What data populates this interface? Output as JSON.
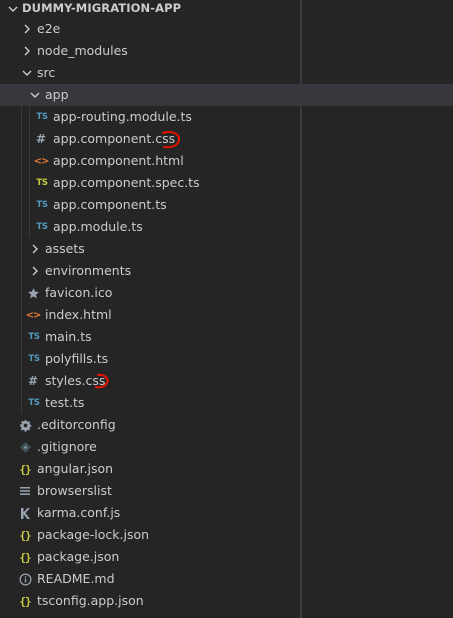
{
  "explorer": {
    "root_title": "DUMMY-MIGRATION-APP",
    "items": [
      {
        "label": "e2e",
        "type": "folder",
        "expanded": false,
        "icon": "chevron-right-icon"
      },
      {
        "label": "node_modules",
        "type": "folder",
        "expanded": false,
        "icon": "chevron-right-icon"
      },
      {
        "label": "src",
        "type": "folder",
        "expanded": true,
        "icon": "chevron-down-icon"
      },
      {
        "label": "app",
        "type": "folder",
        "expanded": true,
        "selected": true,
        "icon": "chevron-down-icon"
      },
      {
        "label": "app-routing.module.ts",
        "type": "file",
        "icon": "typescript-icon",
        "badge": "TS"
      },
      {
        "label": "app.component.css",
        "type": "file",
        "icon": "css-icon",
        "badge": "#",
        "annotated": true
      },
      {
        "label": "app.component.html",
        "type": "file",
        "icon": "html-icon",
        "badge": "<>"
      },
      {
        "label": "app.component.spec.ts",
        "type": "file",
        "icon": "typescript-spec-icon",
        "badge": "TS"
      },
      {
        "label": "app.component.ts",
        "type": "file",
        "icon": "typescript-icon",
        "badge": "TS"
      },
      {
        "label": "app.module.ts",
        "type": "file",
        "icon": "typescript-icon",
        "badge": "TS"
      },
      {
        "label": "assets",
        "type": "folder",
        "expanded": false,
        "icon": "chevron-right-icon"
      },
      {
        "label": "environments",
        "type": "folder",
        "expanded": false,
        "icon": "chevron-right-icon"
      },
      {
        "label": "favicon.ico",
        "type": "file",
        "icon": "star-icon"
      },
      {
        "label": "index.html",
        "type": "file",
        "icon": "html-icon",
        "badge": "<>"
      },
      {
        "label": "main.ts",
        "type": "file",
        "icon": "typescript-icon",
        "badge": "TS"
      },
      {
        "label": "polyfills.ts",
        "type": "file",
        "icon": "typescript-icon",
        "badge": "TS"
      },
      {
        "label": "styles.css",
        "type": "file",
        "icon": "css-icon",
        "badge": "#",
        "annotated": true
      },
      {
        "label": "test.ts",
        "type": "file",
        "icon": "typescript-icon",
        "badge": "TS"
      },
      {
        "label": ".editorconfig",
        "type": "file",
        "icon": "gear-icon"
      },
      {
        "label": ".gitignore",
        "type": "file",
        "icon": "git-diamond-icon"
      },
      {
        "label": "angular.json",
        "type": "file",
        "icon": "json-icon",
        "badge": "{}"
      },
      {
        "label": "browserslist",
        "type": "file",
        "icon": "list-lines-icon"
      },
      {
        "label": "karma.conf.js",
        "type": "file",
        "icon": "karma-icon"
      },
      {
        "label": "package-lock.json",
        "type": "file",
        "icon": "json-icon",
        "badge": "{}"
      },
      {
        "label": "package.json",
        "type": "file",
        "icon": "json-icon",
        "badge": "{}"
      },
      {
        "label": "README.md",
        "type": "file",
        "icon": "info-icon"
      },
      {
        "label": "tsconfig.app.json",
        "type": "file",
        "icon": "json-icon",
        "badge": "{}"
      }
    ],
    "colors": {
      "background": "#252526",
      "selected_row": "#37373d",
      "text": "#cccccc",
      "ts_badge": "#519aba",
      "spec_badge": "#cbcb41",
      "html_icon": "#e37933",
      "json_icon": "#cbcb41",
      "annotation": "#e51400"
    }
  }
}
